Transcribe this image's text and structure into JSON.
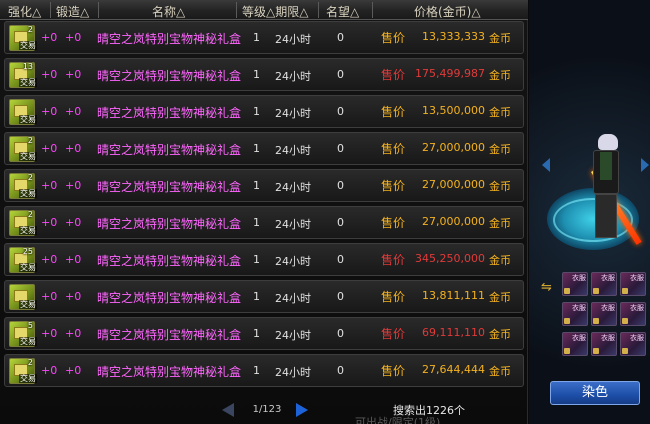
{
  "header": {
    "enhance": "强化△",
    "forge": "锻造△",
    "name": "名称△",
    "level_duration": "等级△期限△",
    "reputation": "名望△",
    "price": "价格(金币)△"
  },
  "rows": [
    {
      "count": "2",
      "tag": "交易",
      "enhance": "+0",
      "forge": "+0",
      "name": "晴空之岚特别宝物神秘礼盒",
      "level": "1",
      "duration": "24小时",
      "reputation": "0",
      "price_label": "售价",
      "price": "13,333,333",
      "currency": "金币",
      "price_color": "#f4b21f"
    },
    {
      "count": "13",
      "tag": "交易",
      "enhance": "+0",
      "forge": "+0",
      "name": "晴空之岚特别宝物神秘礼盒",
      "level": "1",
      "duration": "24小时",
      "reputation": "0",
      "price_label": "售价",
      "price": "175,499,987",
      "currency": "金币",
      "price_color": "#e23a3a"
    },
    {
      "count": "",
      "tag": "交易",
      "enhance": "+0",
      "forge": "+0",
      "name": "晴空之岚特别宝物神秘礼盒",
      "level": "1",
      "duration": "24小时",
      "reputation": "0",
      "price_label": "售价",
      "price": "13,500,000",
      "currency": "金币",
      "price_color": "#f4b21f"
    },
    {
      "count": "2",
      "tag": "交易",
      "enhance": "+0",
      "forge": "+0",
      "name": "晴空之岚特别宝物神秘礼盒",
      "level": "1",
      "duration": "24小时",
      "reputation": "0",
      "price_label": "售价",
      "price": "27,000,000",
      "currency": "金币",
      "price_color": "#f4b21f"
    },
    {
      "count": "2",
      "tag": "交易",
      "enhance": "+0",
      "forge": "+0",
      "name": "晴空之岚特别宝物神秘礼盒",
      "level": "1",
      "duration": "24小时",
      "reputation": "0",
      "price_label": "售价",
      "price": "27,000,000",
      "currency": "金币",
      "price_color": "#f4b21f"
    },
    {
      "count": "2",
      "tag": "交易",
      "enhance": "+0",
      "forge": "+0",
      "name": "晴空之岚特别宝物神秘礼盒",
      "level": "1",
      "duration": "24小时",
      "reputation": "0",
      "price_label": "售价",
      "price": "27,000,000",
      "currency": "金币",
      "price_color": "#f4b21f"
    },
    {
      "count": "25",
      "tag": "交易",
      "enhance": "+0",
      "forge": "+0",
      "name": "晴空之岚特别宝物神秘礼盒",
      "level": "1",
      "duration": "24小时",
      "reputation": "0",
      "price_label": "售价",
      "price": "345,250,000",
      "currency": "金币",
      "price_color": "#e23a3a"
    },
    {
      "count": "",
      "tag": "交易",
      "enhance": "+0",
      "forge": "+0",
      "name": "晴空之岚特别宝物神秘礼盒",
      "level": "1",
      "duration": "24小时",
      "reputation": "0",
      "price_label": "售价",
      "price": "13,811,111",
      "currency": "金币",
      "price_color": "#f4b21f"
    },
    {
      "count": "5",
      "tag": "交易",
      "enhance": "+0",
      "forge": "+0",
      "name": "晴空之岚特别宝物神秘礼盒",
      "level": "1",
      "duration": "24小时",
      "reputation": "0",
      "price_label": "售价",
      "price": "69,111,110",
      "currency": "金币",
      "price_color": "#e23a3a"
    },
    {
      "count": "2",
      "tag": "交易",
      "enhance": "+0",
      "forge": "+0",
      "name": "晴空之岚特别宝物神秘礼盒",
      "level": "1",
      "duration": "24小时",
      "reputation": "0",
      "price_label": "售价",
      "price": "27,644,444",
      "currency": "金币",
      "price_color": "#f4b21f"
    }
  ],
  "price_label_colors": [
    "#f4b21f",
    "#e23a3a",
    "#f4b21f",
    "#f4b21f",
    "#f4b21f",
    "#f4b21f",
    "#e23a3a",
    "#f4b21f",
    "#e23a3a",
    "#f4b21f"
  ],
  "pagination": {
    "page": "1/123"
  },
  "search_result": "搜索出1226个",
  "bottom_faint_text": "可出战/限定(1级)",
  "right_panel": {
    "dye_button": "染色",
    "swap_icon": "swap-icon",
    "slots": [
      {
        "label": "衣服"
      },
      {
        "label": "衣服"
      },
      {
        "label": "衣服"
      },
      {
        "label": "衣服"
      },
      {
        "label": "衣服"
      },
      {
        "label": "衣服"
      },
      {
        "label": "衣服"
      },
      {
        "label": "衣服"
      },
      {
        "label": "衣服"
      }
    ]
  },
  "colors": {
    "gold": "#f4b21f",
    "red_price": "#e23a3a",
    "item_name": "#ff66ff",
    "enhance": "#ff44ff",
    "accent_blue": "#1d4ea8"
  }
}
